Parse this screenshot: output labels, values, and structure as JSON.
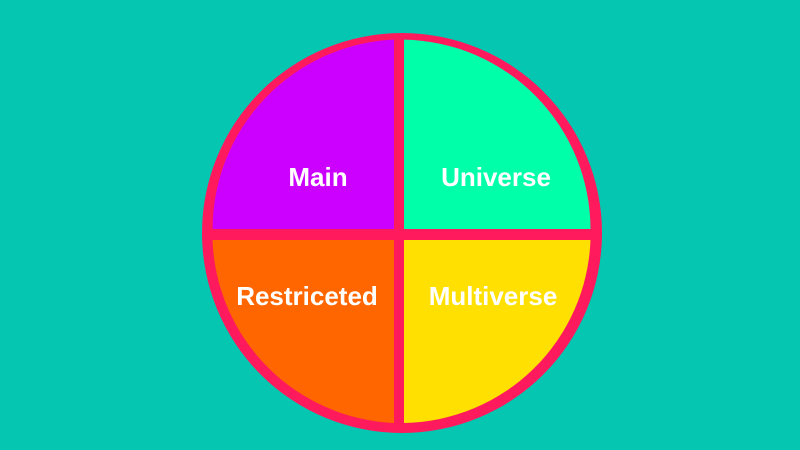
{
  "colors": {
    "background": "#05c6b0",
    "ring": "#ff1a5e",
    "main": "#cc00ff",
    "universe": "#00ffa9",
    "restricted": "#ff6600",
    "multiverse": "#ffe000",
    "label_text": "#ffffff"
  },
  "quadrants": {
    "top_left": {
      "label": "Main"
    },
    "top_right": {
      "label": "Universe"
    },
    "bottom_left": {
      "label": "Restriceted"
    },
    "bottom_right": {
      "label": "Multiverse"
    }
  }
}
